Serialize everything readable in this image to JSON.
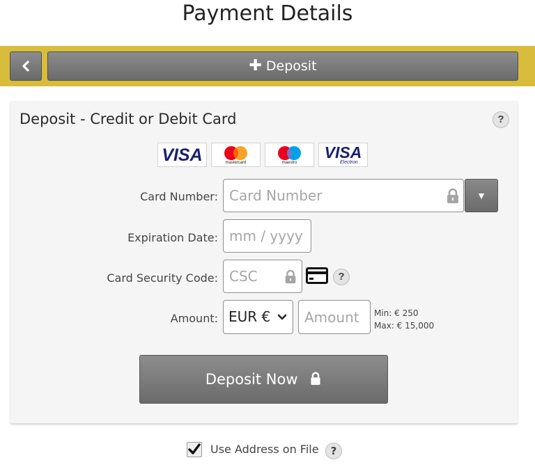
{
  "page": {
    "title": "Payment Details"
  },
  "top_bar": {
    "back_icon": "chevron-left-icon",
    "deposit_tab_label": "Deposit",
    "deposit_tab_icon": "plus-icon",
    "accent_color": "#d8bc3c"
  },
  "panel": {
    "title": "Deposit - Credit or Debit Card",
    "help_text": "?",
    "card_brands": [
      {
        "name": "VISA",
        "icon": "visa-logo"
      },
      {
        "name": "mastercard",
        "icon": "mastercard-logo"
      },
      {
        "name": "maestro",
        "icon": "maestro-logo"
      },
      {
        "name": "VISA",
        "sub": "Electron",
        "icon": "visa-electron-logo"
      }
    ],
    "card_number": {
      "label": "Card Number:",
      "placeholder": "Card Number",
      "dropdown_icon": "caret-down-icon"
    },
    "expiration": {
      "label": "Expiration Date:",
      "placeholder": "mm / yyyy"
    },
    "csc": {
      "label": "Card Security Code:",
      "placeholder": "CSC",
      "help_text": "?",
      "card_icon": "credit-card-icon"
    },
    "amount": {
      "label": "Amount:",
      "currency_selected": "EUR €",
      "placeholder": "Amount",
      "min_text": "Min: € 250",
      "max_text": "Max: € 15,000"
    },
    "submit_label": "Deposit Now"
  },
  "address": {
    "label": "Use Address on File",
    "checked": true,
    "help_text": "?"
  }
}
